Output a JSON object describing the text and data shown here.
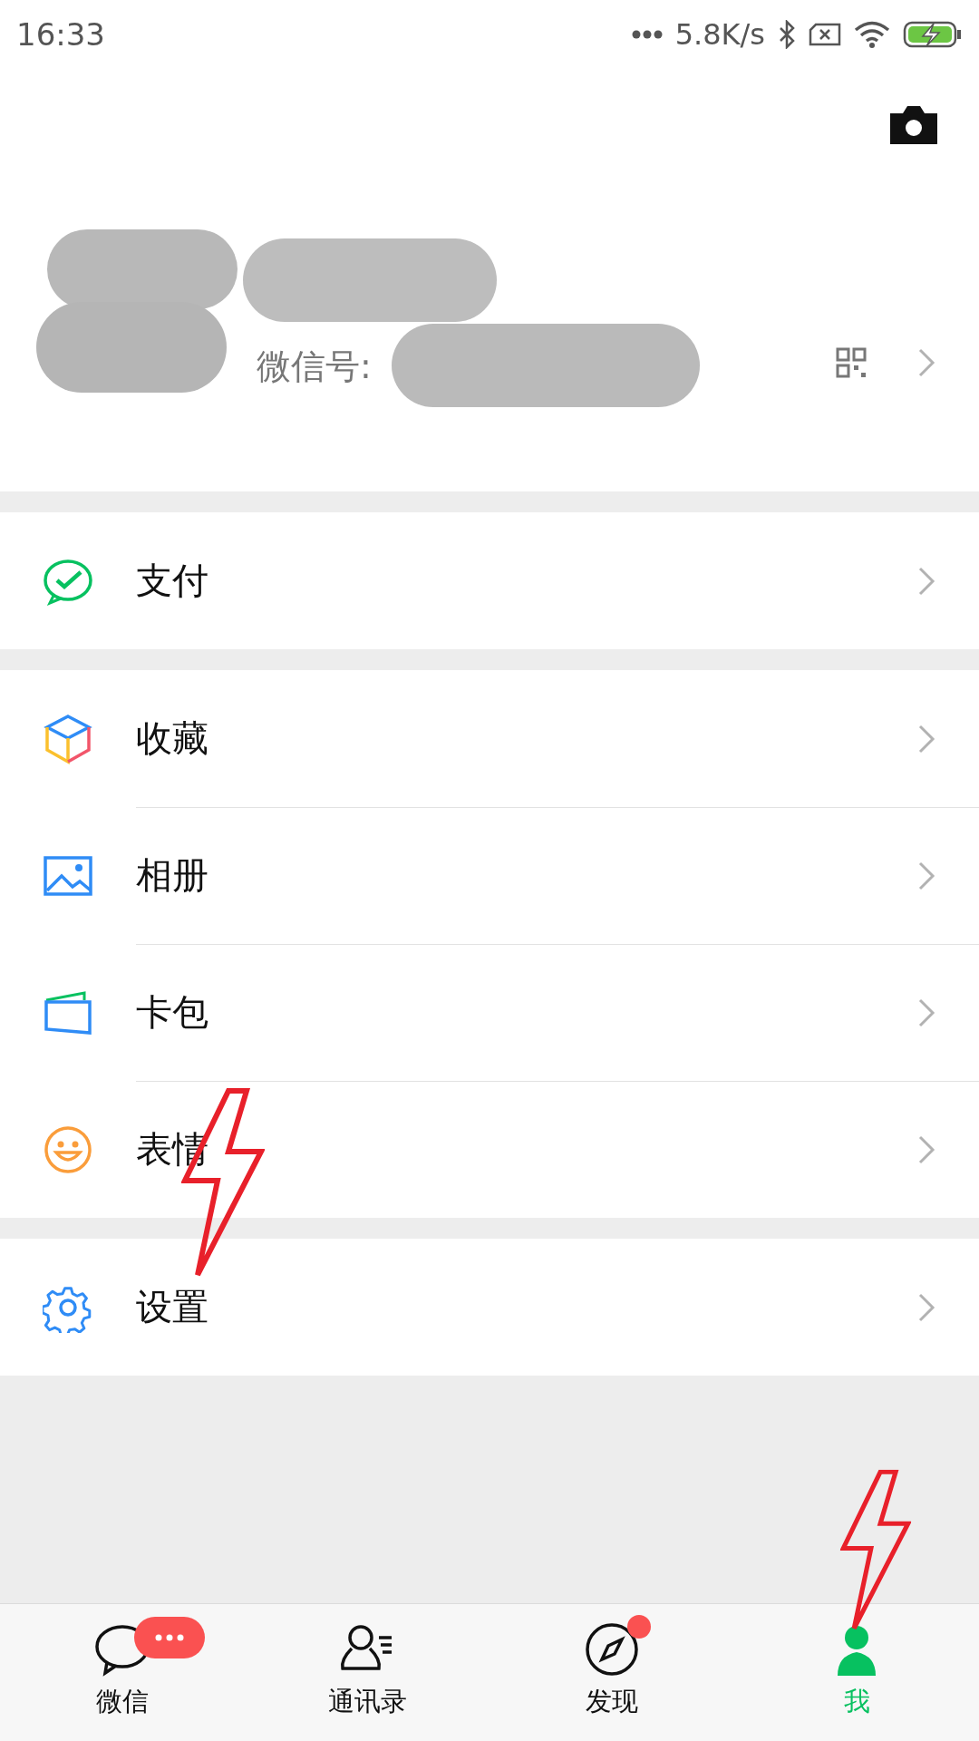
{
  "status_bar": {
    "time": "16:33",
    "network_speed": "5.8K/s"
  },
  "profile": {
    "wechat_id_label": "微信号:"
  },
  "sections": [
    [
      {
        "kind": "pay",
        "label": "支付"
      }
    ],
    [
      {
        "kind": "favorites",
        "label": "收藏"
      },
      {
        "kind": "album",
        "label": "相册"
      },
      {
        "kind": "cards",
        "label": "卡包"
      },
      {
        "kind": "stickers",
        "label": "表情"
      }
    ],
    [
      {
        "kind": "settings",
        "label": "设置"
      }
    ]
  ],
  "tabs": [
    {
      "kind": "chats",
      "label": "微信",
      "selected": false,
      "unread_dots": true,
      "red_dot": false
    },
    {
      "kind": "contacts",
      "label": "通讯录",
      "selected": false,
      "unread_dots": false,
      "red_dot": false
    },
    {
      "kind": "discover",
      "label": "发现",
      "selected": false,
      "unread_dots": false,
      "red_dot": true
    },
    {
      "kind": "me",
      "label": "我",
      "selected": true,
      "unread_dots": false,
      "red_dot": false
    }
  ]
}
